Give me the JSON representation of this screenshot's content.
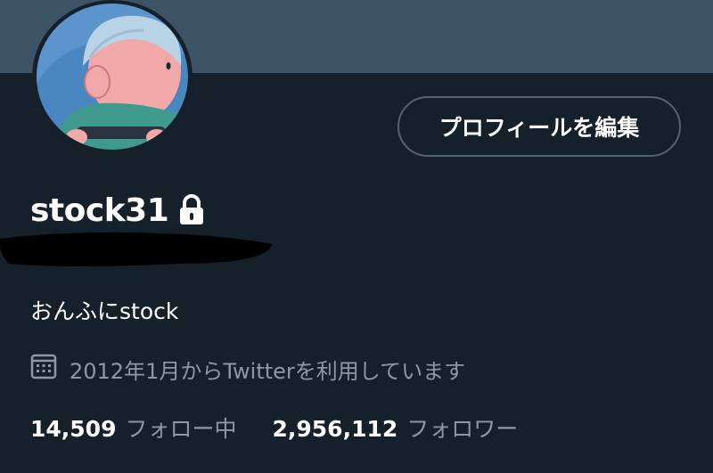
{
  "profile": {
    "username": "stock31",
    "bio": "おんふにstock",
    "joined": "2012年1月からTwitterを利用しています",
    "edit_button_label": "プロフィールを編集",
    "lock_icon": "lock-icon",
    "calendar_icon": "calendar-icon"
  },
  "stats": {
    "following_count": "14,509",
    "following_label": "フォロー中",
    "followers_count": "2,956,112",
    "followers_label": "フォロワー"
  },
  "colors": {
    "background": "#15202b",
    "banner": "#3d5466",
    "secondary_text": "#8b98a5",
    "button_border": "#536471"
  }
}
